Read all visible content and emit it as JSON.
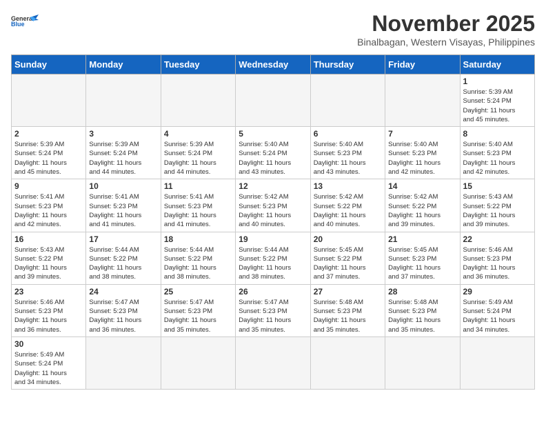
{
  "header": {
    "logo_general": "General",
    "logo_blue": "Blue",
    "month_title": "November 2025",
    "subtitle": "Binalbagan, Western Visayas, Philippines"
  },
  "weekdays": [
    "Sunday",
    "Monday",
    "Tuesday",
    "Wednesday",
    "Thursday",
    "Friday",
    "Saturday"
  ],
  "weeks": [
    [
      {
        "day": "",
        "info": ""
      },
      {
        "day": "",
        "info": ""
      },
      {
        "day": "",
        "info": ""
      },
      {
        "day": "",
        "info": ""
      },
      {
        "day": "",
        "info": ""
      },
      {
        "day": "",
        "info": ""
      },
      {
        "day": "1",
        "info": "Sunrise: 5:39 AM\nSunset: 5:24 PM\nDaylight: 11 hours\nand 45 minutes."
      }
    ],
    [
      {
        "day": "2",
        "info": "Sunrise: 5:39 AM\nSunset: 5:24 PM\nDaylight: 11 hours\nand 45 minutes."
      },
      {
        "day": "3",
        "info": "Sunrise: 5:39 AM\nSunset: 5:24 PM\nDaylight: 11 hours\nand 44 minutes."
      },
      {
        "day": "4",
        "info": "Sunrise: 5:39 AM\nSunset: 5:24 PM\nDaylight: 11 hours\nand 44 minutes."
      },
      {
        "day": "5",
        "info": "Sunrise: 5:40 AM\nSunset: 5:24 PM\nDaylight: 11 hours\nand 43 minutes."
      },
      {
        "day": "6",
        "info": "Sunrise: 5:40 AM\nSunset: 5:23 PM\nDaylight: 11 hours\nand 43 minutes."
      },
      {
        "day": "7",
        "info": "Sunrise: 5:40 AM\nSunset: 5:23 PM\nDaylight: 11 hours\nand 42 minutes."
      },
      {
        "day": "8",
        "info": "Sunrise: 5:40 AM\nSunset: 5:23 PM\nDaylight: 11 hours\nand 42 minutes."
      }
    ],
    [
      {
        "day": "9",
        "info": "Sunrise: 5:41 AM\nSunset: 5:23 PM\nDaylight: 11 hours\nand 42 minutes."
      },
      {
        "day": "10",
        "info": "Sunrise: 5:41 AM\nSunset: 5:23 PM\nDaylight: 11 hours\nand 41 minutes."
      },
      {
        "day": "11",
        "info": "Sunrise: 5:41 AM\nSunset: 5:23 PM\nDaylight: 11 hours\nand 41 minutes."
      },
      {
        "day": "12",
        "info": "Sunrise: 5:42 AM\nSunset: 5:23 PM\nDaylight: 11 hours\nand 40 minutes."
      },
      {
        "day": "13",
        "info": "Sunrise: 5:42 AM\nSunset: 5:22 PM\nDaylight: 11 hours\nand 40 minutes."
      },
      {
        "day": "14",
        "info": "Sunrise: 5:42 AM\nSunset: 5:22 PM\nDaylight: 11 hours\nand 39 minutes."
      },
      {
        "day": "15",
        "info": "Sunrise: 5:43 AM\nSunset: 5:22 PM\nDaylight: 11 hours\nand 39 minutes."
      }
    ],
    [
      {
        "day": "16",
        "info": "Sunrise: 5:43 AM\nSunset: 5:22 PM\nDaylight: 11 hours\nand 39 minutes."
      },
      {
        "day": "17",
        "info": "Sunrise: 5:44 AM\nSunset: 5:22 PM\nDaylight: 11 hours\nand 38 minutes."
      },
      {
        "day": "18",
        "info": "Sunrise: 5:44 AM\nSunset: 5:22 PM\nDaylight: 11 hours\nand 38 minutes."
      },
      {
        "day": "19",
        "info": "Sunrise: 5:44 AM\nSunset: 5:22 PM\nDaylight: 11 hours\nand 38 minutes."
      },
      {
        "day": "20",
        "info": "Sunrise: 5:45 AM\nSunset: 5:22 PM\nDaylight: 11 hours\nand 37 minutes."
      },
      {
        "day": "21",
        "info": "Sunrise: 5:45 AM\nSunset: 5:23 PM\nDaylight: 11 hours\nand 37 minutes."
      },
      {
        "day": "22",
        "info": "Sunrise: 5:46 AM\nSunset: 5:23 PM\nDaylight: 11 hours\nand 36 minutes."
      }
    ],
    [
      {
        "day": "23",
        "info": "Sunrise: 5:46 AM\nSunset: 5:23 PM\nDaylight: 11 hours\nand 36 minutes."
      },
      {
        "day": "24",
        "info": "Sunrise: 5:47 AM\nSunset: 5:23 PM\nDaylight: 11 hours\nand 36 minutes."
      },
      {
        "day": "25",
        "info": "Sunrise: 5:47 AM\nSunset: 5:23 PM\nDaylight: 11 hours\nand 35 minutes."
      },
      {
        "day": "26",
        "info": "Sunrise: 5:47 AM\nSunset: 5:23 PM\nDaylight: 11 hours\nand 35 minutes."
      },
      {
        "day": "27",
        "info": "Sunrise: 5:48 AM\nSunset: 5:23 PM\nDaylight: 11 hours\nand 35 minutes."
      },
      {
        "day": "28",
        "info": "Sunrise: 5:48 AM\nSunset: 5:23 PM\nDaylight: 11 hours\nand 35 minutes."
      },
      {
        "day": "29",
        "info": "Sunrise: 5:49 AM\nSunset: 5:24 PM\nDaylight: 11 hours\nand 34 minutes."
      }
    ],
    [
      {
        "day": "30",
        "info": "Sunrise: 5:49 AM\nSunset: 5:24 PM\nDaylight: 11 hours\nand 34 minutes."
      },
      {
        "day": "",
        "info": ""
      },
      {
        "day": "",
        "info": ""
      },
      {
        "day": "",
        "info": ""
      },
      {
        "day": "",
        "info": ""
      },
      {
        "day": "",
        "info": ""
      },
      {
        "day": "",
        "info": ""
      }
    ]
  ]
}
